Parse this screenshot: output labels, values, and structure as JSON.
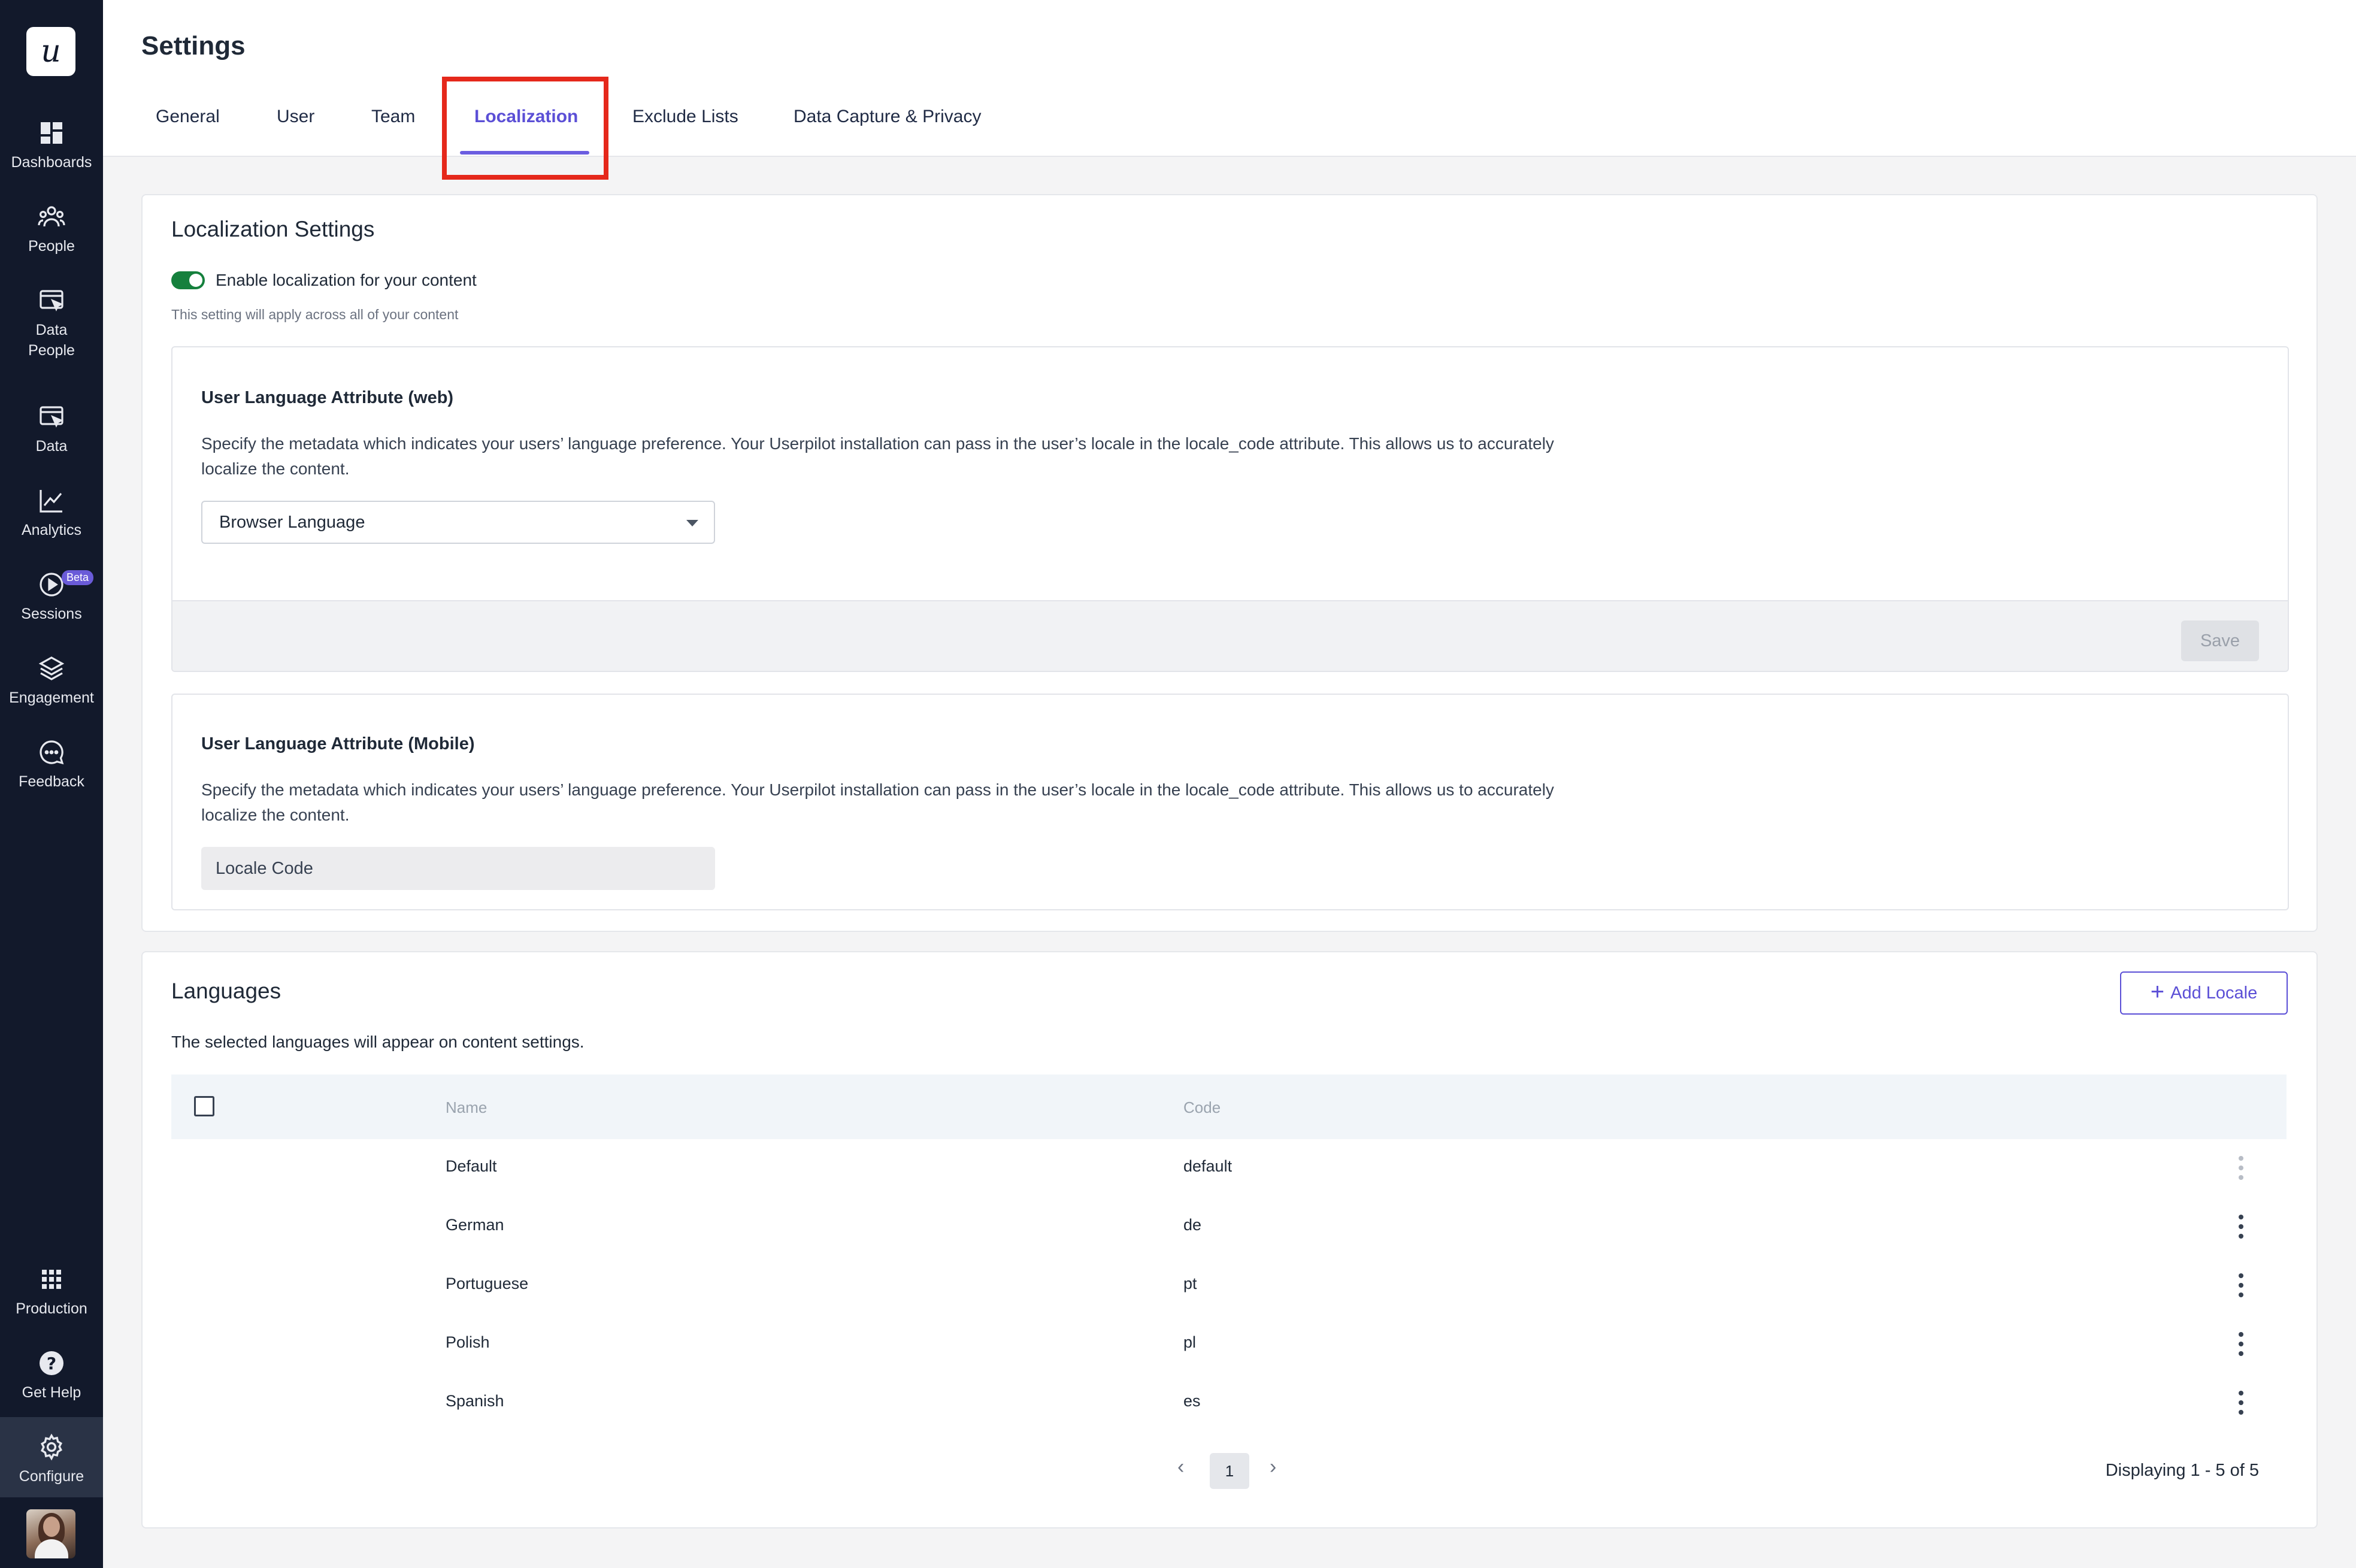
{
  "sidebar": {
    "logo": "u",
    "items": [
      {
        "label": "Dashboards",
        "icon": "dashboard-icon"
      },
      {
        "label": "People",
        "icon": "people-icon"
      },
      {
        "label": "Data\nPeople",
        "icon": "data-people-icon"
      },
      {
        "label": "Data",
        "icon": "data-icon"
      },
      {
        "label": "Analytics",
        "icon": "analytics-icon"
      },
      {
        "label": "Sessions",
        "icon": "play-circle-icon",
        "badge": "Beta"
      },
      {
        "label": "Engagement",
        "icon": "layers-icon"
      },
      {
        "label": "Feedback",
        "icon": "chat-bubble-icon"
      },
      {
        "label": "Production",
        "icon": "grid-icon"
      },
      {
        "label": "Get Help",
        "icon": "help-circle-icon"
      },
      {
        "label": "Configure",
        "icon": "gear-icon",
        "active": true
      }
    ]
  },
  "header": {
    "title": "Settings",
    "tabs": [
      {
        "label": "General"
      },
      {
        "label": "User"
      },
      {
        "label": "Team"
      },
      {
        "label": "Localization",
        "active": true
      },
      {
        "label": "Exclude Lists"
      },
      {
        "label": "Data Capture & Privacy"
      }
    ]
  },
  "localization": {
    "title": "Localization Settings",
    "toggle_label": "Enable localization for your content",
    "toggle_on": true,
    "toggle_hint": "This setting will apply across all of your content",
    "web": {
      "heading": "User Language Attribute (web)",
      "description": "Specify the metadata which indicates your users’ language preference. Your Userpilot installation can pass in the user’s locale in the locale_code attribute. This allows us to accurately localize the content.",
      "select_value": "Browser Language",
      "save_label": "Save"
    },
    "mobile": {
      "heading": "User Language Attribute (Mobile)",
      "description": "Specify the metadata which indicates your users’ language preference. Your Userpilot installation can pass in the user’s locale in the locale_code attribute. This allows us to accurately localize the content.",
      "input_value": "Locale Code"
    }
  },
  "languages": {
    "title": "Languages",
    "description": "The selected languages will appear on content settings.",
    "add_label": "Add Locale",
    "columns": {
      "name": "Name",
      "code": "Code"
    },
    "rows": [
      {
        "name": "Default",
        "code": "default"
      },
      {
        "name": "German",
        "code": "de"
      },
      {
        "name": "Portuguese",
        "code": "pt"
      },
      {
        "name": "Polish",
        "code": "pl"
      },
      {
        "name": "Spanish",
        "code": "es"
      }
    ],
    "pagination": {
      "prev": "‹",
      "page": "1",
      "next": "›",
      "summary": "Displaying 1 - 5 of 5"
    }
  },
  "colors": {
    "accent": "#5b4fd6",
    "sidebar": "#12192b",
    "toggle": "#15803d",
    "highlight": "#e5281b"
  }
}
